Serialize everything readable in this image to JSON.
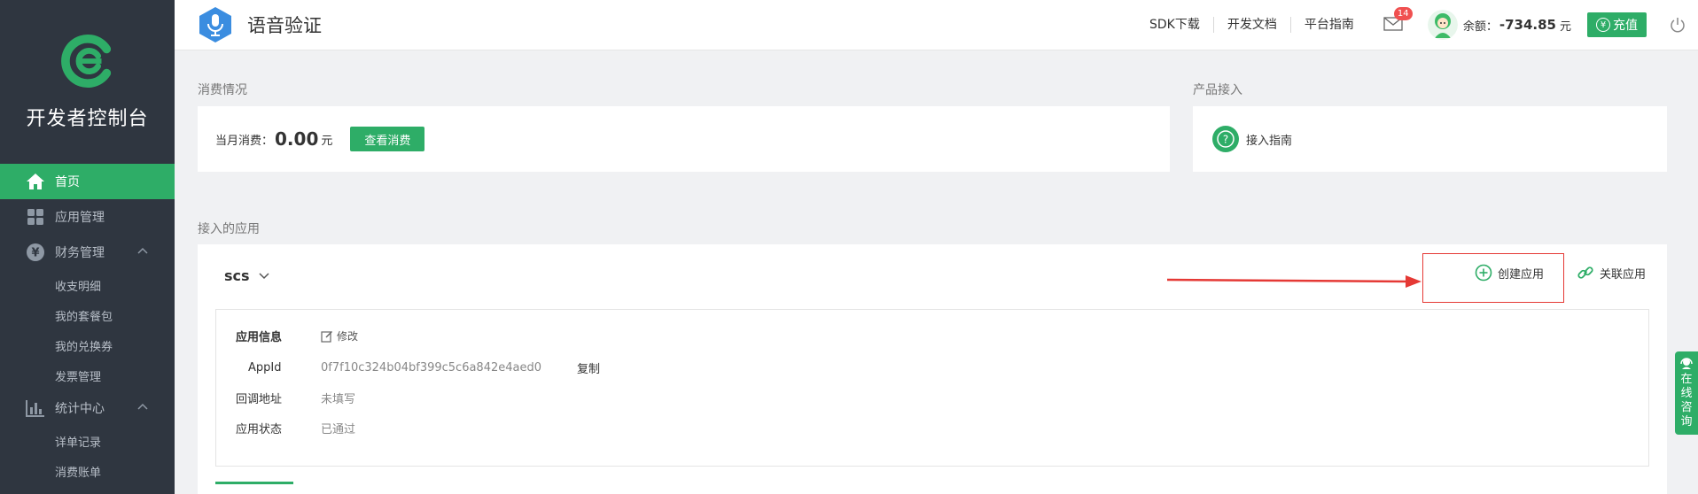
{
  "sidebar": {
    "title": "开发者控制台",
    "items": [
      {
        "label": "首页",
        "icon": "home-icon",
        "active": true
      },
      {
        "label": "应用管理",
        "icon": "grid-icon"
      },
      {
        "label": "财务管理",
        "icon": "yen-icon",
        "expanded": true
      },
      {
        "label": "收支明细"
      },
      {
        "label": "我的套餐包"
      },
      {
        "label": "我的兑换券"
      },
      {
        "label": "发票管理"
      },
      {
        "label": "统计中心",
        "icon": "bar-chart-icon",
        "expanded": true
      },
      {
        "label": "详单记录"
      },
      {
        "label": "消费账单"
      }
    ]
  },
  "header": {
    "product_title": "语音验证",
    "links": [
      "SDK下载",
      "开发文档",
      "平台指南"
    ],
    "mail_count": "14",
    "balance_label": "余额：",
    "balance_value": "-734.85",
    "balance_unit": "元",
    "recharge_symbol": "¥",
    "recharge_label": "充值"
  },
  "consumption": {
    "section_title": "消费情况",
    "label": "当月消费：",
    "value": "0.00",
    "unit": "元",
    "button": "查看消费"
  },
  "product_access": {
    "section_title": "产品接入",
    "guide_symbol": "?",
    "guide_label": "接入指南"
  },
  "apps": {
    "section_title": "接入的应用",
    "current_app": "scs",
    "create_label": "创建应用",
    "link_label": "关联应用",
    "info": {
      "header_label": "应用信息",
      "edit_label": "修改",
      "appid_label": "AppId",
      "appid_value": "0f7f10c324b04bf399c5c6a842e4aed0",
      "copy_label": "复制",
      "callback_label": "回调地址",
      "callback_value": "未填写",
      "status_label": "应用状态",
      "status_value": "已通过"
    }
  },
  "consult": {
    "label_chars": [
      "在",
      "线",
      "咨",
      "询"
    ]
  },
  "colors": {
    "accent": "#2ead67",
    "sidebar_bg": "#2f3640",
    "annotation_red": "#e53935"
  }
}
